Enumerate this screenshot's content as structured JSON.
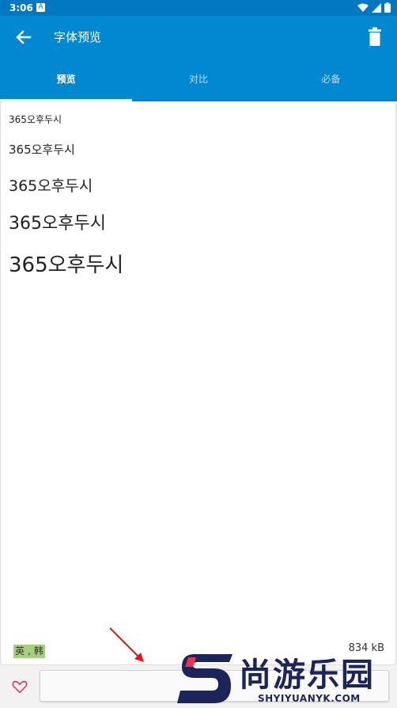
{
  "status_bar": {
    "time": "3:06",
    "notification_icon": "A"
  },
  "app_bar": {
    "title": "字体预览"
  },
  "tabs": [
    {
      "label": "预览",
      "active": true
    },
    {
      "label": "对比",
      "active": false
    },
    {
      "label": "必备",
      "active": false
    }
  ],
  "preview": {
    "samples": [
      "365오후두시",
      "365오후두시",
      "365오후두시",
      "365오후두시",
      "365오후두시"
    ],
    "languages": [
      "英",
      "韩"
    ],
    "language_separator": ",",
    "file_size": "834 kB"
  },
  "watermark": {
    "brand": "尚游乐园",
    "url": "SHYIYUANYK.COM"
  },
  "colors": {
    "primary": "#0288d1",
    "status_bar": "#0277c2",
    "tag": "#a6d07e",
    "accent": "#e8334a"
  },
  "icons": [
    "back-arrow-icon",
    "trash-icon",
    "heart-icon",
    "wifi-icon",
    "signal-icon",
    "battery-icon"
  ]
}
